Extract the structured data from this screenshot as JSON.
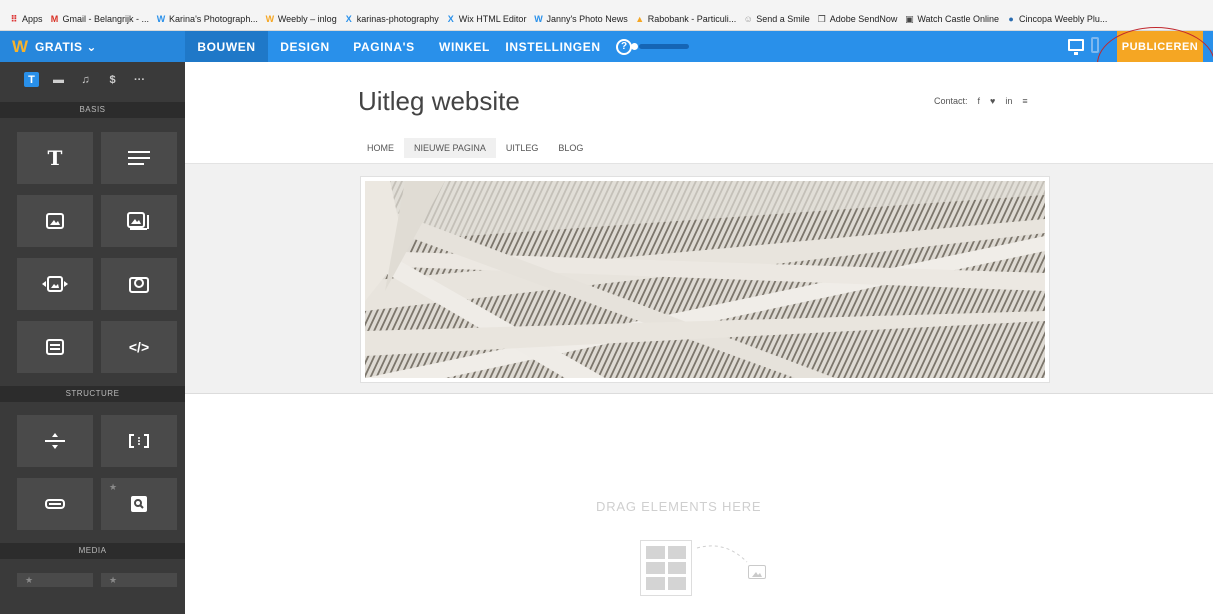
{
  "bookmarks": [
    {
      "label": "Apps",
      "icon": "apps-grid-icon",
      "color": "#d33"
    },
    {
      "label": "Gmail - Belangrijk - ...",
      "icon": "gmail-icon",
      "color": "#d93025"
    },
    {
      "label": "Karina's Photograph...",
      "icon": "weebly-icon",
      "color": "#2990ea"
    },
    {
      "label": "Weebly – inlog",
      "icon": "weebly-icon",
      "color": "#f5a623"
    },
    {
      "label": "karinas-photography",
      "icon": "wix-icon",
      "color": "#2990ea"
    },
    {
      "label": "Wix HTML Editor",
      "icon": "wix-icon",
      "color": "#2990ea"
    },
    {
      "label": "Janny's Photo News",
      "icon": "weebly-icon",
      "color": "#2990ea"
    },
    {
      "label": "Rabobank - Particuli...",
      "icon": "rabobank-icon",
      "color": "#f5a623"
    },
    {
      "label": "Send a Smile",
      "icon": "smile-icon",
      "color": "#999"
    },
    {
      "label": "Adobe SendNow",
      "icon": "adobe-icon",
      "color": "#444"
    },
    {
      "label": "Watch Castle Online",
      "icon": "castle-icon",
      "color": "#444"
    },
    {
      "label": "Cincopa Weebly Plu...",
      "icon": "cincopa-icon",
      "color": "#2a6cb0"
    }
  ],
  "topnav": {
    "brand_logo": "W",
    "plan": "GRATIS ⌄",
    "tabs": [
      {
        "label": "BOUWEN",
        "active": true
      },
      {
        "label": "DESIGN",
        "active": false
      },
      {
        "label": "PAGINA'S",
        "active": false
      },
      {
        "label": "WINKEL",
        "active": false
      },
      {
        "label": "INSTELLINGEN",
        "active": false
      }
    ],
    "help": "?",
    "publish": "PUBLICEREN",
    "accent": "#2990ea",
    "publish_color": "#f5a623"
  },
  "sidebar": {
    "tabs": [
      "T",
      "▬",
      "♫",
      "$",
      "···"
    ],
    "sections": {
      "basis": "BASIS",
      "structure": "STRUCTURE",
      "media": "MEDIA"
    }
  },
  "site": {
    "title": "Uitleg website",
    "contact_label": "Contact:",
    "social": [
      "f",
      "♥",
      "in",
      "≡"
    ],
    "nav": [
      {
        "label": "HOME",
        "active": false
      },
      {
        "label": "NIEUWE PAGINA",
        "active": true
      },
      {
        "label": "UITLEG",
        "active": false
      },
      {
        "label": "BLOG",
        "active": false
      }
    ]
  },
  "drop": {
    "text": "DRAG ELEMENTS HERE"
  }
}
